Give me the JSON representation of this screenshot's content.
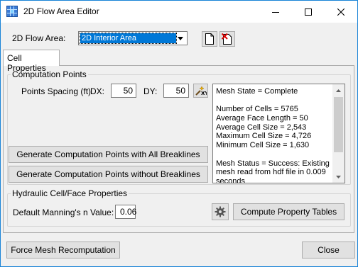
{
  "window": {
    "title": "2D Flow Area Editor",
    "app_icon": "grid-app-icon",
    "controls": [
      "minimize-icon",
      "maximize-icon",
      "close-icon"
    ]
  },
  "flow_area": {
    "label": "2D Flow Area:",
    "selected": "2D Interior Area"
  },
  "tabs": [
    {
      "label": "Cell Properties",
      "active": true
    }
  ],
  "computation_points": {
    "group_title": "Computation Points",
    "spacing_label": "Points Spacing (ft)",
    "dx_label": "DX:",
    "dx_value": "50",
    "dy_label": "DY:",
    "dy_value": "50",
    "btn_with_breaklines": "Generate Computation Points with All Breaklines",
    "btn_without_breaklines": "Generate Computation Points without Breaklines"
  },
  "mesh_info": {
    "lines": [
      "Mesh State = Complete",
      "",
      "Number of Cells = 5765",
      "Average Face Length = 50",
      "Average Cell Size = 2,543",
      "Maximum Cell Size = 4,726",
      "Minimum Cell Size = 1,630",
      "",
      "Mesh Status = Success: Existing",
      "mesh read from hdf file in 0.009",
      "seconds"
    ]
  },
  "hydraulic": {
    "group_title": "Hydraulic Cell/Face Properties",
    "mannings_label": "Default Manning's n Value:",
    "mannings_value": "0.06",
    "compute_button": "Compute Property Tables"
  },
  "footer": {
    "force_button": "Force Mesh Recomputation",
    "close_button": "Close"
  },
  "colors": {
    "accent": "#0078d7",
    "window_border": "#1883d7",
    "background": "#f0f0f0"
  }
}
